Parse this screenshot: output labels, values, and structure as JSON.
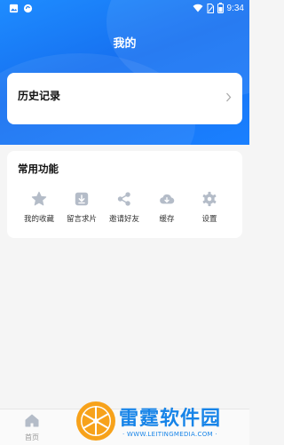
{
  "status_bar": {
    "time": "9:34",
    "left_icons": [
      "image-icon",
      "notification-icon"
    ],
    "right_icons": [
      "wifi-icon",
      "sim-icon",
      "battery-icon"
    ]
  },
  "page": {
    "title": "我的"
  },
  "history": {
    "label": "历史记录"
  },
  "functions": {
    "title": "常用功能",
    "items": [
      {
        "label": "我的收藏",
        "icon": "star-icon"
      },
      {
        "label": "留言求片",
        "icon": "download-box-icon"
      },
      {
        "label": "邀请好友",
        "icon": "share-icon"
      },
      {
        "label": "缓存",
        "icon": "cloud-download-icon"
      },
      {
        "label": "设置",
        "icon": "gear-icon"
      }
    ]
  },
  "tab_bar": {
    "home_label": "首页"
  },
  "watermark": {
    "title": "雷霆软件园",
    "url": "· WWW.LEITINGMEDIA.COM ·"
  },
  "colors": {
    "accent": "#1a7cf5",
    "icon_gray": "#b4bcc8",
    "background": "#f5f5f5"
  }
}
